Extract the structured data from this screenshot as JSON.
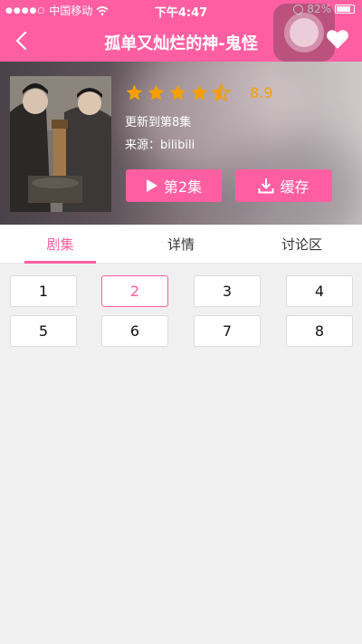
{
  "status_bar": {
    "carrier": "中国移动",
    "time": "下午4:47",
    "battery": "82%"
  },
  "navbar": {
    "title": "孤单又灿烂的神-鬼怪"
  },
  "show": {
    "rating_stars": 4.5,
    "rating_score": "8.9",
    "update_status": "更新到第8集",
    "source": "来源：bilibili"
  },
  "actions": {
    "play_label": "第2集",
    "cache_label": "缓存"
  },
  "tabs": [
    {
      "label": "剧集",
      "active": true
    },
    {
      "label": "详情",
      "active": false
    },
    {
      "label": "讨论区",
      "active": false
    }
  ],
  "episodes": [
    {
      "label": "1",
      "active": false
    },
    {
      "label": "2",
      "active": true
    },
    {
      "label": "3",
      "active": false
    },
    {
      "label": "4",
      "active": false
    },
    {
      "label": "5",
      "active": false
    },
    {
      "label": "6",
      "active": false
    },
    {
      "label": "7",
      "active": false
    },
    {
      "label": "8",
      "active": false
    }
  ],
  "colors": {
    "accent": "#ff5fa2",
    "star": "#f5a000",
    "background": "#f0f0f0"
  },
  "icons": {
    "back": "chevron-left-icon",
    "favorite": "heart-icon",
    "play": "play-icon",
    "download": "download-icon",
    "wifi": "wifi-icon",
    "battery": "battery-icon"
  }
}
